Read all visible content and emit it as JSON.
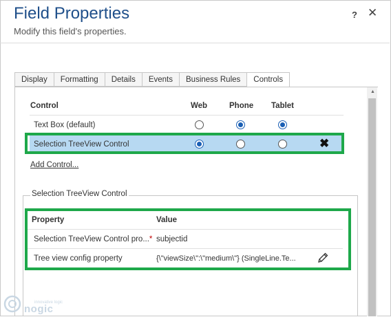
{
  "dialog": {
    "title": "Field Properties",
    "subtitle": "Modify this field's properties.",
    "help_label": "?",
    "close_label": "✕"
  },
  "tabs": [
    {
      "label": "Display"
    },
    {
      "label": "Formatting"
    },
    {
      "label": "Details"
    },
    {
      "label": "Events"
    },
    {
      "label": "Business Rules"
    },
    {
      "label": "Controls",
      "active": true
    }
  ],
  "controls": {
    "headers": {
      "control": "Control",
      "web": "Web",
      "phone": "Phone",
      "tablet": "Tablet"
    },
    "rows": [
      {
        "name": "Text Box (default)",
        "web": false,
        "phone": true,
        "tablet": true
      },
      {
        "name": "Selection TreeView Control",
        "web": true,
        "phone": false,
        "tablet": false,
        "selected": true,
        "remove_icon": "✖"
      }
    ],
    "add_link": "Add Control..."
  },
  "properties": {
    "legend": "Selection TreeView Control",
    "headers": {
      "property": "Property",
      "value": "Value"
    },
    "rows": [
      {
        "name": "Selection TreeView Control pro...",
        "required_mark": "*",
        "value": "subjectid"
      },
      {
        "name": "Tree view config property",
        "value": "{\\\"viewSize\\\":\\\"medium\\\"} (SingleLine.Te...",
        "edit_icon": "pencil-icon"
      }
    ]
  },
  "watermark": {
    "tagline": "innovative logic",
    "brand": "nogic"
  },
  "colors": {
    "title": "#1f4f8a",
    "selection": "#b7d9f2",
    "highlight_box": "#1ea84a",
    "radio": "#1a5fb4",
    "required": "#c00000"
  }
}
